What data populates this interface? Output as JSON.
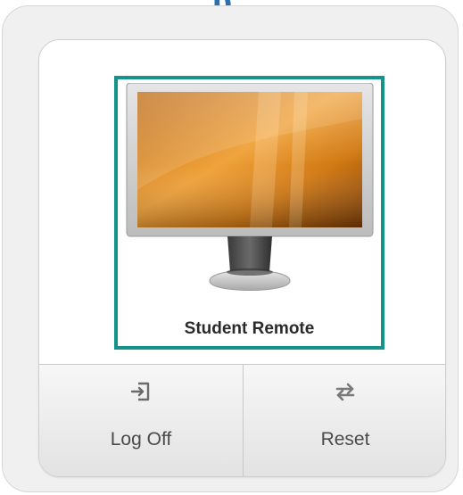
{
  "header": {
    "title_fragment": "p"
  },
  "desktop": {
    "name": "Student Remote",
    "icon": "monitor-icon"
  },
  "actions": [
    {
      "label": "Log Off",
      "icon": "log-off-icon"
    },
    {
      "label": "Reset",
      "icon": "reset-arrows-icon"
    }
  ],
  "colors": {
    "title": "#2a6fb0",
    "selection_border": "#14938b",
    "label_text": "#2a2a2a",
    "action_text": "#4a4a4a"
  }
}
